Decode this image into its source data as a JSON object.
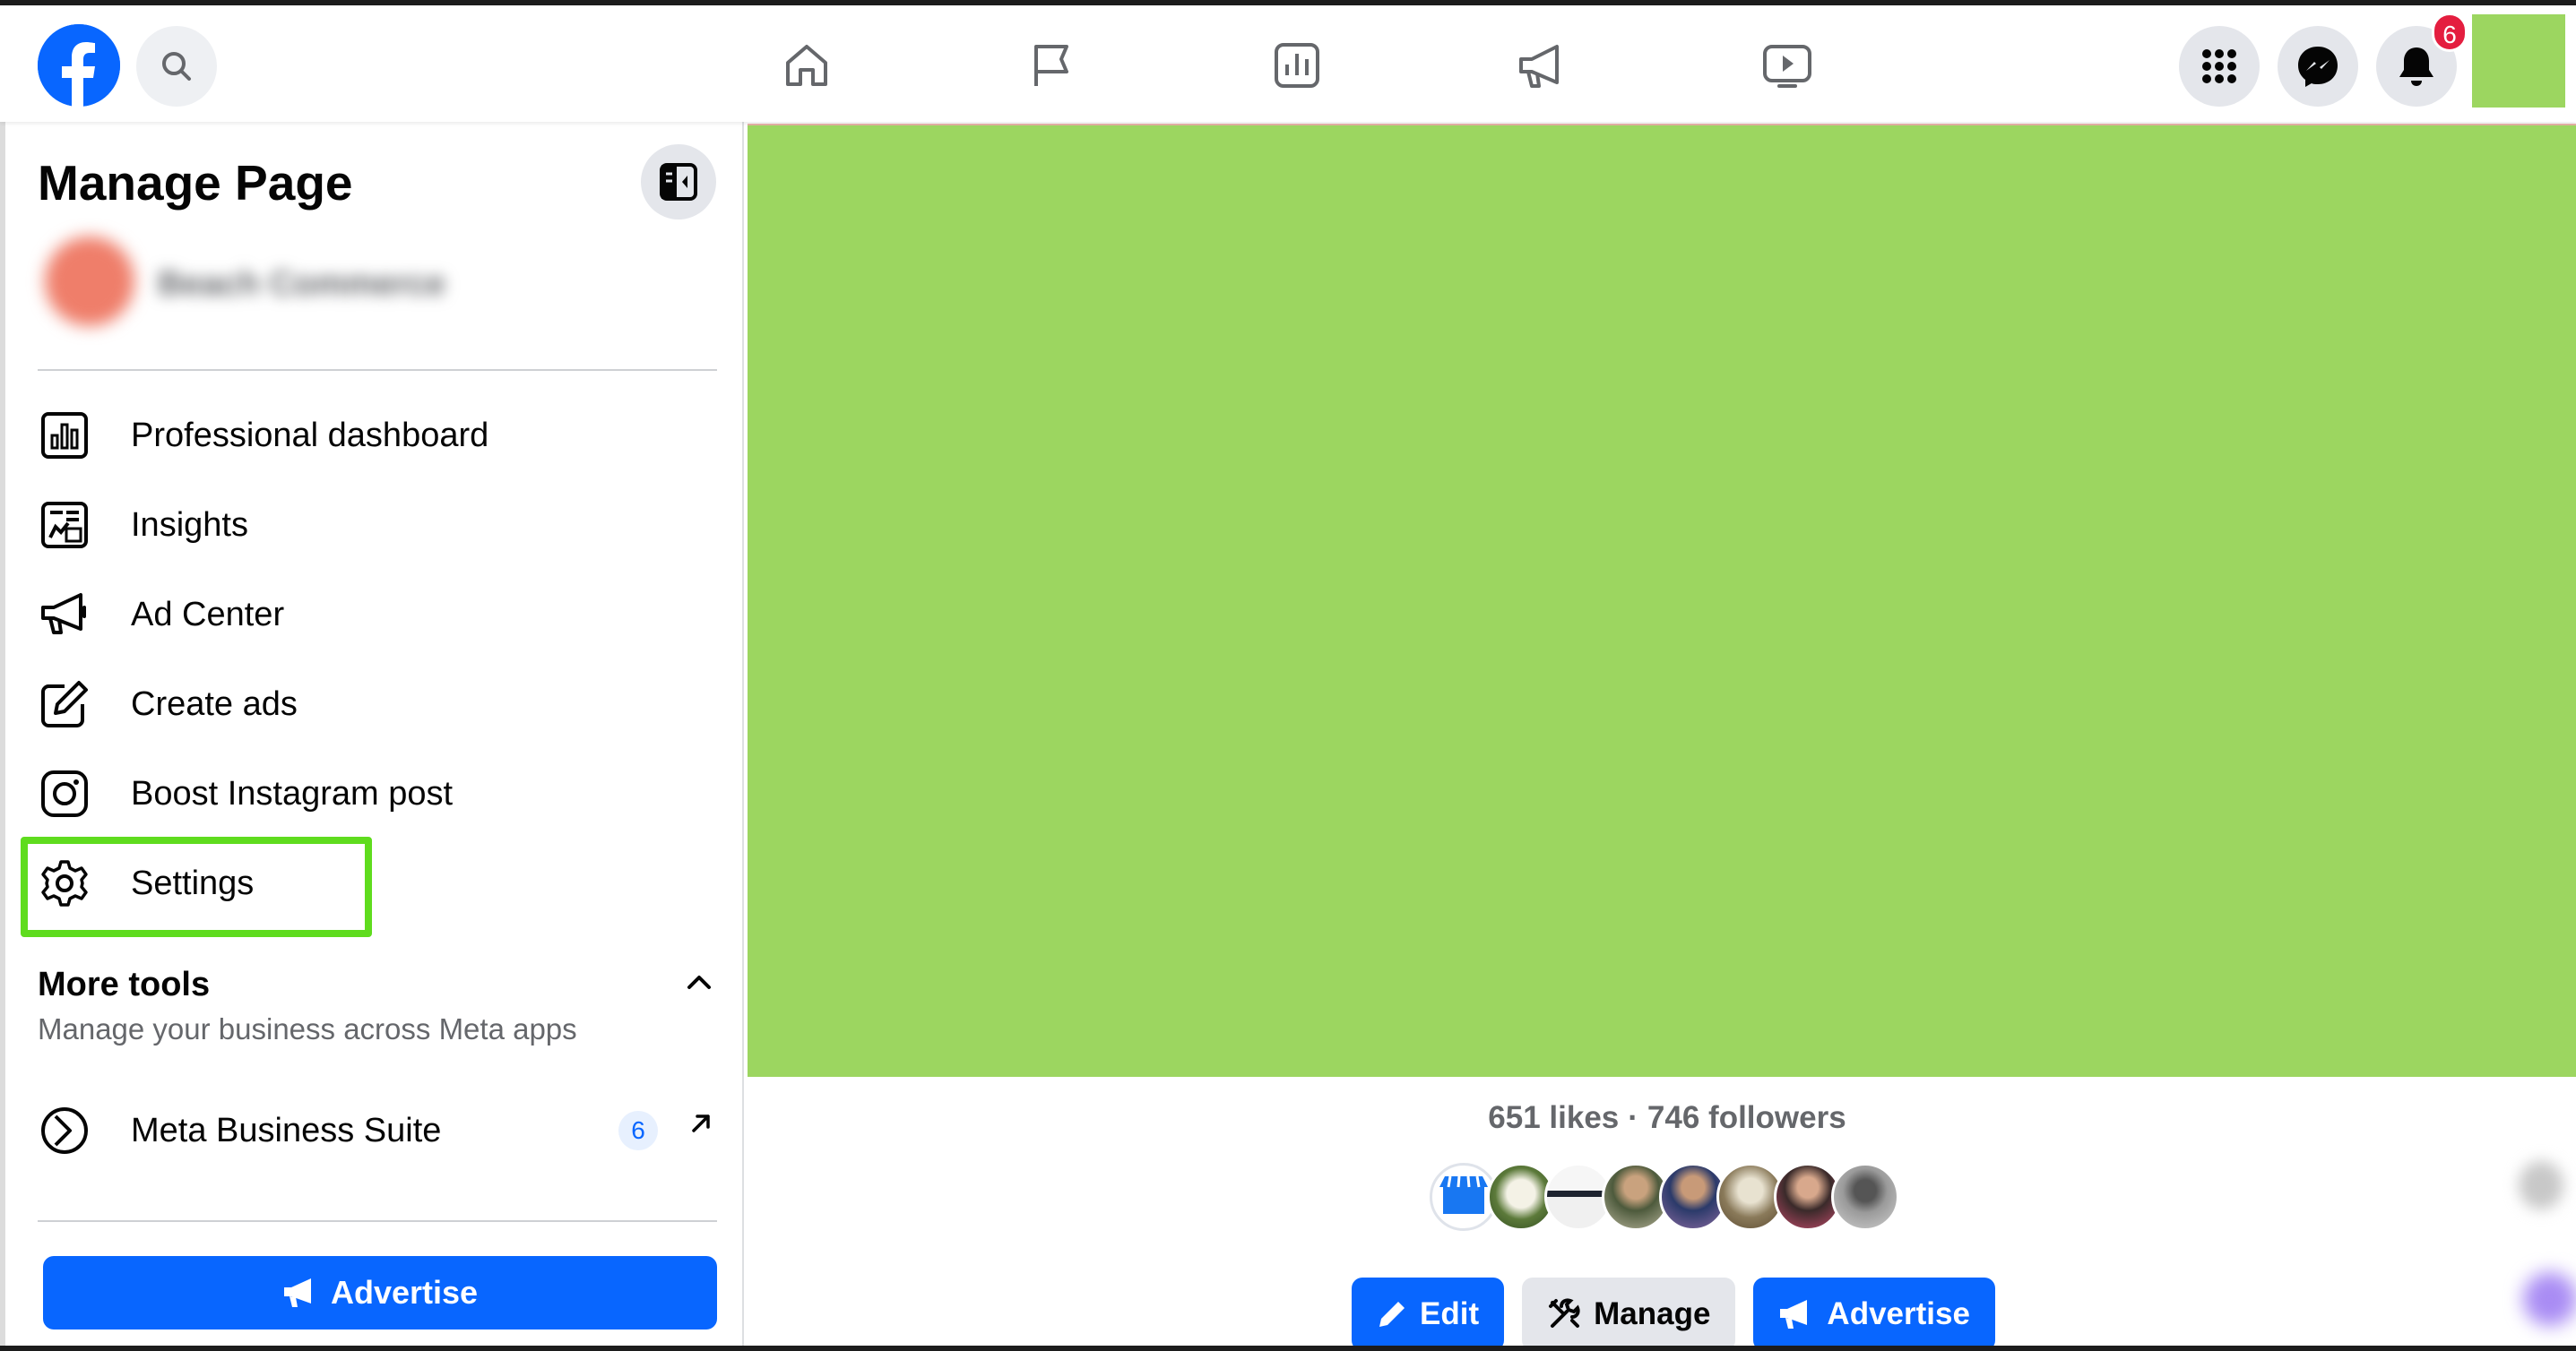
{
  "sidebar": {
    "title": "Manage Page",
    "page_name": "Beach Commerce",
    "menu": [
      {
        "label": "Professional dashboard",
        "icon": "dashboard-icon"
      },
      {
        "label": "Insights",
        "icon": "insights-icon"
      },
      {
        "label": "Ad Center",
        "icon": "megaphone-icon"
      },
      {
        "label": "Create ads",
        "icon": "edit-square-icon"
      },
      {
        "label": "Boost Instagram post",
        "icon": "instagram-icon"
      },
      {
        "label": "Settings",
        "icon": "gear-icon"
      }
    ],
    "more_tools": {
      "title": "More tools",
      "subtitle": "Manage your business across Meta apps",
      "items": [
        {
          "label": "Meta Business Suite",
          "badge": "6",
          "icon": "meta-business-suite-icon"
        }
      ]
    },
    "advertise_label": "Advertise"
  },
  "topbar": {
    "notifications_count": "6",
    "nav_icons": [
      "home-icon",
      "flag-icon",
      "dashboard-icon",
      "megaphone-icon",
      "video-icon"
    ]
  },
  "main": {
    "likes": "651 likes",
    "separator": "·",
    "followers": "746 followers",
    "actions": {
      "edit_label": "Edit",
      "manage_label": "Manage",
      "advertise_label": "Advertise"
    }
  },
  "colors": {
    "brand_blue": "#0866ff",
    "cover_green": "#9cd660",
    "highlight_green": "#5fdc1e",
    "badge_red": "#e41e3f"
  }
}
